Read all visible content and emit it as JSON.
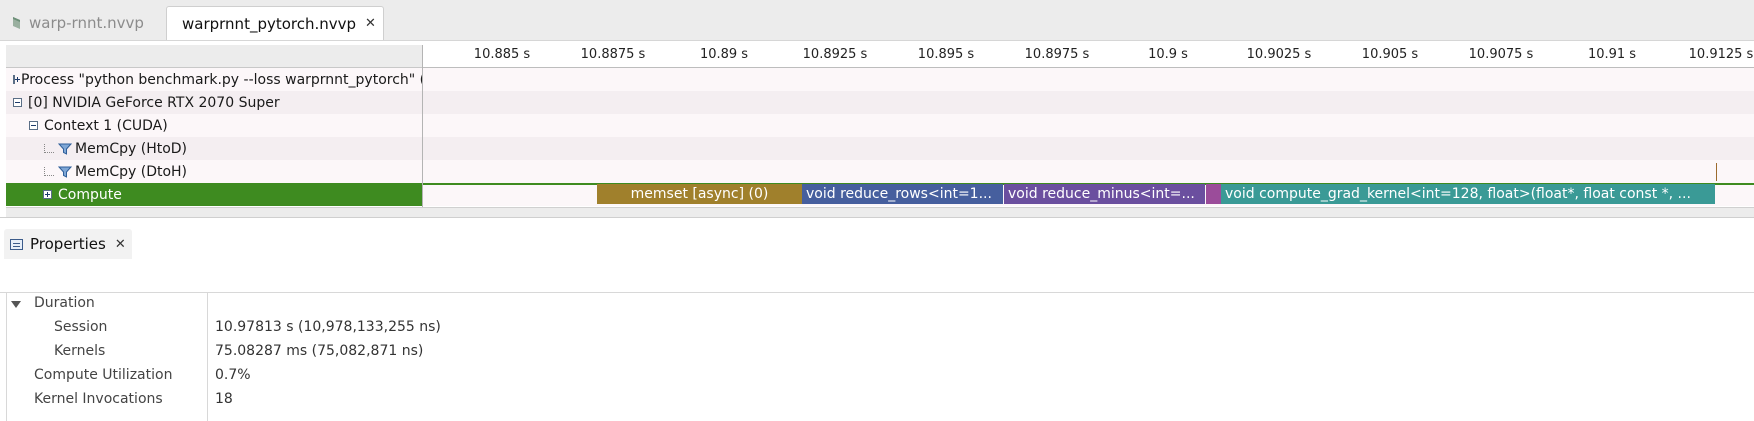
{
  "tabs": [
    {
      "label": "warp-rnnt.nvvp",
      "active": false
    },
    {
      "label": "warprnnt_pytorch.nvvp",
      "active": true
    }
  ],
  "timeline": {
    "ticks": [
      "10.885 s",
      "10.8875 s",
      "10.89 s",
      "10.8925 s",
      "10.895 s",
      "10.8975 s",
      "10.9 s",
      "10.9025 s",
      "10.905 s",
      "10.9075 s",
      "10.91 s",
      "10.9125 s"
    ],
    "rows": [
      "Process \"python benchmark.py --loss warprnnt_pytorch\" (...",
      "[0] NVIDIA GeForce RTX 2070 Super",
      "Context 1 (CUDA)",
      "MemCpy (HtoD)",
      "MemCpy (DtoH)",
      "Compute"
    ],
    "kernels": [
      {
        "label": "memset [async] (0)",
        "color": "#a0802c"
      },
      {
        "label": "void reduce_rows<int=1...",
        "color": "#465f9e"
      },
      {
        "label": "void reduce_minus<int=...",
        "color": "#6b4f9f"
      },
      {
        "label": "",
        "color": "#9b4c9a"
      },
      {
        "label": "void compute_grad_kernel<int=128, float>(float*, float const *, ...",
        "color": "#3a9a96"
      }
    ]
  },
  "properties": {
    "tab_label": "Properties",
    "rows": [
      {
        "label": "Duration",
        "value": ""
      },
      {
        "label": "Session",
        "value": "10.97813 s (10,978,133,255 ns)"
      },
      {
        "label": "Kernels",
        "value": "75.08287 ms (75,082,871 ns)"
      },
      {
        "label": "Compute Utilization",
        "value": "0.7%"
      },
      {
        "label": "Kernel Invocations",
        "value": "18"
      }
    ]
  },
  "colors": {
    "compute_row": "#3e8b20",
    "accent": "#1d3b6b"
  }
}
